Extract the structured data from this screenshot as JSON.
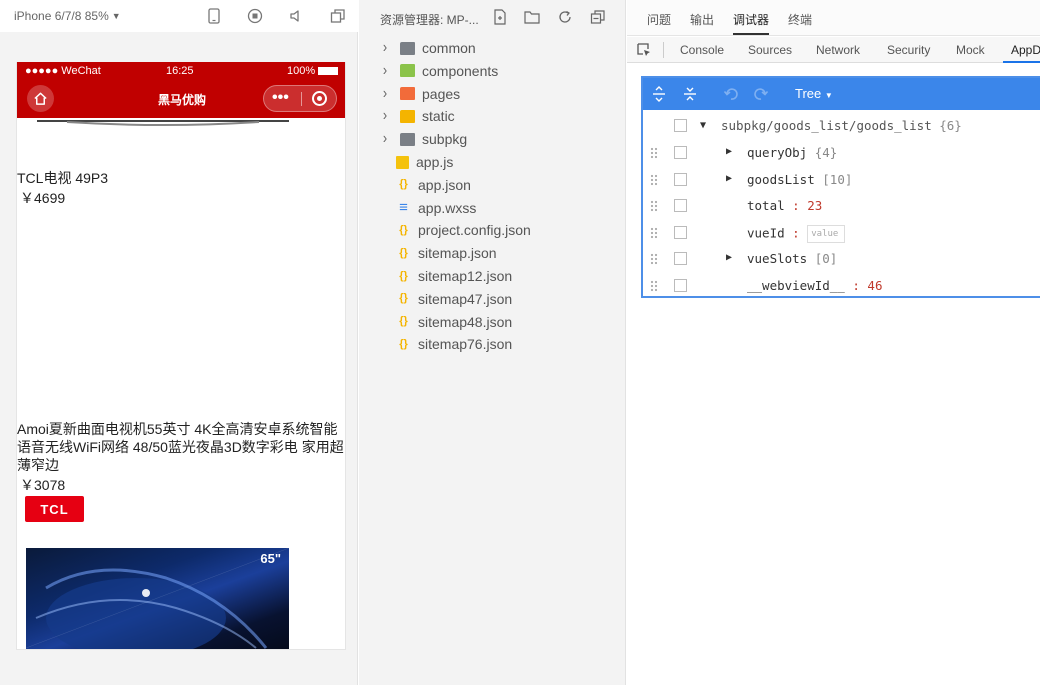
{
  "simulator": {
    "device_label": "iPhone 6/7/8 85%",
    "statusbar": {
      "carrier": "●●●●● WeChat",
      "time": "16:25",
      "battery": "100%"
    },
    "navbar_title": "黑马优购",
    "capsule_dots": "•••",
    "goods": [
      {
        "name": "TCL电视 49P3",
        "price": "￥4699"
      },
      {
        "name": "Amoi夏新曲面电视机55英寸 4K全高清安卓系统智能语音无线WiFi网络 48/50蓝光夜晶3D数字彩电 家用超薄窄边",
        "price": "￥3078"
      }
    ],
    "brand_logo": "TCL",
    "tv_size_label": "65\""
  },
  "explorer": {
    "title": "资源管理器: MP-...",
    "items": [
      {
        "label": "common",
        "kind": "folder",
        "icon": "folder-icon",
        "color": "#7a7f86"
      },
      {
        "label": "components",
        "kind": "folder",
        "icon": "components-folder-icon",
        "color": "#8bc34a"
      },
      {
        "label": "pages",
        "kind": "folder",
        "icon": "pages-folder-icon",
        "color": "#f26b3a"
      },
      {
        "label": "static",
        "kind": "folder",
        "icon": "static-folder-icon",
        "color": "#f4b400"
      },
      {
        "label": "subpkg",
        "kind": "folder",
        "icon": "folder-icon",
        "color": "#7a7f86"
      },
      {
        "label": "app.js",
        "kind": "file",
        "icon": "js-file-icon",
        "color": "#f4c20d"
      },
      {
        "label": "app.json",
        "kind": "file",
        "icon": "json-file-icon",
        "color": "#f4b400"
      },
      {
        "label": "app.wxss",
        "kind": "file",
        "icon": "css-file-icon",
        "color": "#3b86ea"
      },
      {
        "label": "project.config.json",
        "kind": "file",
        "icon": "json-file-icon",
        "color": "#f4b400"
      },
      {
        "label": "sitemap.json",
        "kind": "file",
        "icon": "json-file-icon",
        "color": "#f4b400"
      },
      {
        "label": "sitemap12.json",
        "kind": "file",
        "icon": "json-file-icon",
        "color": "#f4b400"
      },
      {
        "label": "sitemap47.json",
        "kind": "file",
        "icon": "json-file-icon",
        "color": "#f4b400"
      },
      {
        "label": "sitemap48.json",
        "kind": "file",
        "icon": "json-file-icon",
        "color": "#f4b400"
      },
      {
        "label": "sitemap76.json",
        "kind": "file",
        "icon": "json-file-icon",
        "color": "#f4b400"
      }
    ]
  },
  "devtools": {
    "top_tabs": [
      "问题",
      "输出",
      "调试器",
      "终端"
    ],
    "active_top_tab": "调试器",
    "panel_tabs": [
      "Console",
      "Sources",
      "Network",
      "Security",
      "Mock",
      "AppD"
    ],
    "active_panel_tab": "AppD",
    "appdata": {
      "mode": "Tree",
      "root_path": "subpkg/goods_list/goods_list",
      "root_count": "{6}",
      "rows": [
        {
          "key": "queryObj",
          "count": "{4}",
          "expandable": true
        },
        {
          "key": "goodsList",
          "count": "[10]",
          "expandable": true
        },
        {
          "key": "total",
          "value": "23",
          "expandable": false
        },
        {
          "key": "vueId",
          "placeholder": "value",
          "expandable": false
        },
        {
          "key": "vueSlots",
          "count": "[0]",
          "expandable": true
        },
        {
          "key": "__webviewId__",
          "value": "46",
          "expandable": false
        }
      ]
    }
  },
  "colors": {
    "wechat_red": "#c00000",
    "devtools_blue": "#3b86ea",
    "number_red": "#c0392b"
  }
}
